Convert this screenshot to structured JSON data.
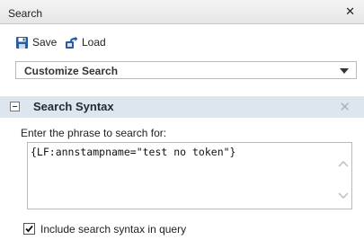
{
  "panel": {
    "title": "Search",
    "close_glyph": "✕"
  },
  "toolbar": {
    "save_label": "Save",
    "load_label": "Load",
    "save_icon": "save-disk-icon",
    "load_icon": "load-arrow-icon"
  },
  "dropdown": {
    "selected": "Customize Search"
  },
  "section": {
    "title": "Search Syntax",
    "close_glyph": "✕"
  },
  "search": {
    "prompt": "Enter the phrase to search for:",
    "value": "{LF:annstampname=\"test no token\"}"
  },
  "options": {
    "include_syntax_label": "Include search syntax in query",
    "include_syntax_checked": true
  },
  "colors": {
    "section_header_bg": "#dde6ee",
    "save_icon": "#2a5d9f",
    "load_icon": "#2a5d9f"
  }
}
